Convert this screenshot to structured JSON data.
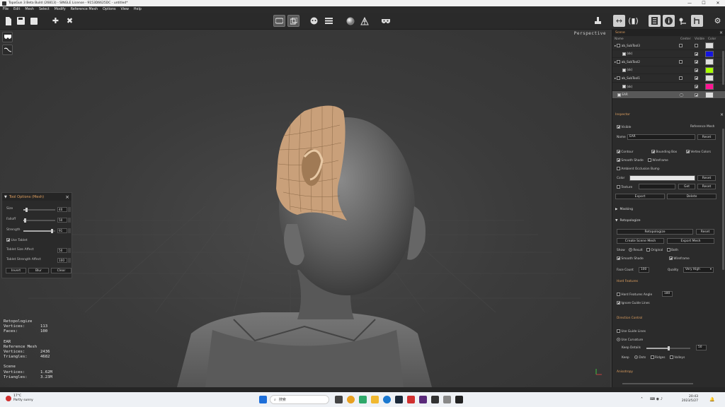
{
  "window": {
    "title": "TopoGun 3 Beta Build (26813) - SINGLE License - 9153D6625DC - untitled*",
    "controls": [
      "—",
      "☐",
      "✕"
    ]
  },
  "menu": [
    "File",
    "Edit",
    "Mesh",
    "Select",
    "Modify",
    "Reference Mesh",
    "Options",
    "View",
    "Help"
  ],
  "viewport": {
    "mode_label": "Perspective",
    "stats": {
      "retopo_title": "Retopologize",
      "retopo_vertices_label": "Vertices:",
      "retopo_vertices": "113",
      "retopo_faces_label": "Faces:",
      "retopo_faces": "100",
      "ear_title": "EAR",
      "ref_title": "Reference Mesh",
      "ref_vertices_label": "Vertices:",
      "ref_vertices": "2436",
      "ref_triangles_label": "Triangles:",
      "ref_triangles": "4682",
      "scene_title": "Scene",
      "scene_vertices_label": "Vertices:",
      "scene_vertices": "1.62M",
      "scene_triangles_label": "Triangles:",
      "scene_triangles": "3.23M"
    }
  },
  "tool_options": {
    "title": "Tool Options (Mesh)",
    "size_label": "Size",
    "size_value": "40",
    "size_fraction": 0.1,
    "falloff_label": "Falloff",
    "falloff_value": "50",
    "falloff_fraction": 0.06,
    "strength_label": "Strength",
    "strength_value": "91",
    "strength_fraction": 0.91,
    "use_tablet_label": "Use Tablet",
    "tablet_size_label": "Tablet Size Affect",
    "tablet_size_value": "50",
    "tablet_strength_label": "Tablet Strength Affect",
    "tablet_strength_value": "100",
    "invert_label": "Invert",
    "blur_label": "Blur",
    "clear_label": "Clear"
  },
  "scene": {
    "title": "Scene",
    "col_name": "Name",
    "col_center": "Center",
    "col_visible": "Visible",
    "col_color": "Color",
    "rows": [
      {
        "name": "ab_SubTool3",
        "color": "#dddddd",
        "indent": 0,
        "visible": false,
        "center": false,
        "selected": false
      },
      {
        "name": "(sk)",
        "color": "#1515e0",
        "indent": 1,
        "visible": true,
        "center": false,
        "selected": false
      },
      {
        "name": "ab_SubTool2",
        "color": "#dddddd",
        "indent": 0,
        "visible": true,
        "center": false,
        "selected": false
      },
      {
        "name": "(sk)",
        "color": "#a8ff00",
        "indent": 1,
        "visible": true,
        "center": false,
        "selected": false
      },
      {
        "name": "ab_SubTool1",
        "color": "#dddddd",
        "indent": 0,
        "visible": true,
        "center": false,
        "selected": false
      },
      {
        "name": "(sk)",
        "color": "#ff1493",
        "indent": 1,
        "visible": true,
        "center": false,
        "selected": false
      },
      {
        "name": "EAR",
        "color": "#dddddd",
        "indent": 0,
        "visible": true,
        "center": true,
        "selected": true
      }
    ]
  },
  "inspector": {
    "title": "Inspector",
    "visible_label": "Visible",
    "reference_mesh_label": "Reference Mesh",
    "name_label": "Name",
    "name_value": "EAR",
    "reset_label": "Reset",
    "contour_label": "Contour",
    "bounding_box_label": "Bounding Box",
    "vertex_colors_label": "Vertex Colors",
    "smooth_shade_label": "Smooth Shade",
    "wireframe_label": "Wireframe",
    "ambient_occlusion_label": "Ambient Occlusion Bump",
    "color_label": "Color",
    "texture_label": "Texture",
    "get_label": "Get",
    "export_label": "Export",
    "delete_label": "Delete"
  },
  "masking": {
    "title": "Masking"
  },
  "retopologize": {
    "title": "Retopologize",
    "retopologize_button": "Retopologize",
    "reset_label": "Reset",
    "create_scene_mesh": "Create Scene Mesh",
    "export_mesh": "Export Mesh",
    "show_label": "Show",
    "result_label": "Result",
    "original_label": "Original",
    "both_label": "Both",
    "smooth_shade_label": "Smooth Shade",
    "wireframe_label": "Wireframe",
    "face_count_label": "Face Count",
    "face_count_value": "100",
    "quality_label": "Quality",
    "quality_value": "Very High",
    "hard_features_title": "Hard Features",
    "hard_features_angle_label": "Hard Features Angle",
    "hard_features_angle_value": "180",
    "ignore_guide_lines_label": "Ignore Guide Lines",
    "direction_control_title": "Direction Control",
    "use_guide_lines_label": "Use Guide Lines",
    "use_curvature_label": "Use Curvature",
    "keep_details_label": "Keep Details",
    "keep_details_value": "50",
    "keep_details_fraction": 0.5,
    "keep_label": "Keep",
    "dots_label": "Dots",
    "ridges_label": "Ridges",
    "valleys_label": "Valleys",
    "anisotropy_title": "Anisotropy"
  },
  "taskbar": {
    "weather_temp": "17°C",
    "weather_desc": "Partly sunny",
    "search_placeholder": "搜索",
    "time": "20:43",
    "date": "2023/5/27"
  }
}
